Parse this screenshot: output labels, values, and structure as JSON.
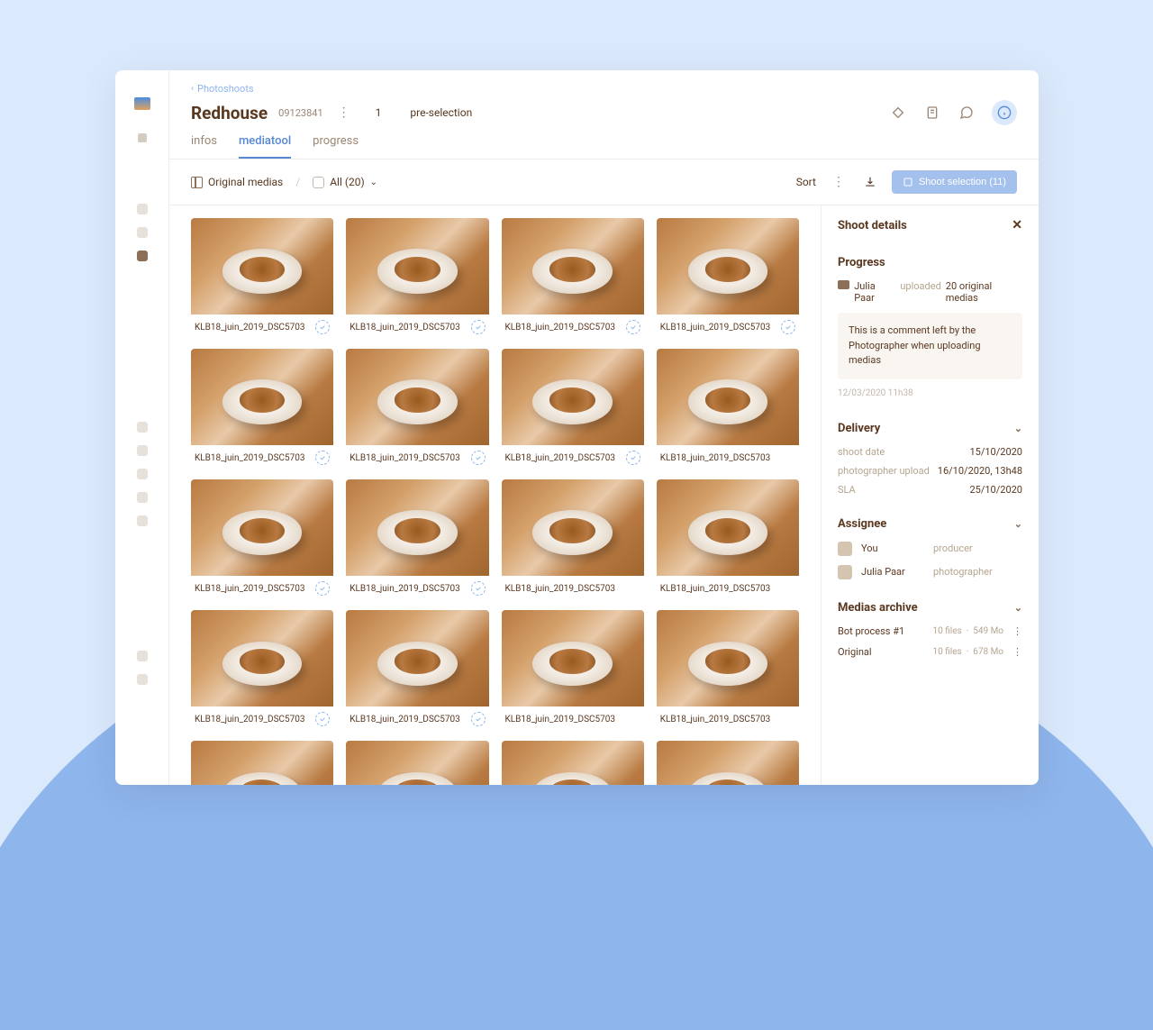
{
  "breadcrumb": {
    "back": "Photoshoots"
  },
  "header": {
    "title": "Redhouse",
    "shoot_id": "09123841",
    "step_number": "1",
    "step_label": "pre-selection"
  },
  "tabs": {
    "infos": "infos",
    "mediatool": "mediatool",
    "progress": "progress"
  },
  "toolbar": {
    "original_medias": "Original medias",
    "all_label": "All (20)",
    "sort": "Sort",
    "shoot_selection": "Shoot selection (11)"
  },
  "media": {
    "items": [
      {
        "filename": "KLB18_juin_2019_DSC5703",
        "badge": true
      },
      {
        "filename": "KLB18_juin_2019_DSC5703",
        "badge": true
      },
      {
        "filename": "KLB18_juin_2019_DSC5703",
        "badge": true
      },
      {
        "filename": "KLB18_juin_2019_DSC5703",
        "badge": true
      },
      {
        "filename": "KLB18_juin_2019_DSC5703",
        "badge": true
      },
      {
        "filename": "KLB18_juin_2019_DSC5703",
        "badge": true
      },
      {
        "filename": "KLB18_juin_2019_DSC5703",
        "badge": true
      },
      {
        "filename": "KLB18_juin_2019_DSC5703",
        "badge": false
      },
      {
        "filename": "KLB18_juin_2019_DSC5703",
        "badge": true
      },
      {
        "filename": "KLB18_juin_2019_DSC5703",
        "badge": true
      },
      {
        "filename": "KLB18_juin_2019_DSC5703",
        "badge": false
      },
      {
        "filename": "KLB18_juin_2019_DSC5703",
        "badge": false
      },
      {
        "filename": "KLB18_juin_2019_DSC5703",
        "badge": true
      },
      {
        "filename": "KLB18_juin_2019_DSC5703",
        "badge": true
      },
      {
        "filename": "KLB18_juin_2019_DSC5703",
        "badge": false
      },
      {
        "filename": "KLB18_juin_2019_DSC5703",
        "badge": false
      },
      {
        "filename": "",
        "badge": false
      },
      {
        "filename": "",
        "badge": false
      },
      {
        "filename": "",
        "badge": false
      },
      {
        "filename": "",
        "badge": false
      }
    ]
  },
  "details": {
    "panel_title": "Shoot details",
    "progress": {
      "title": "Progress",
      "actor": "Julia Paar",
      "verb": "uploaded",
      "object": "20 original medias",
      "comment": "This is a comment left by the Photographer when uploading medias",
      "timestamp": "12/03/2020 11h38"
    },
    "delivery": {
      "title": "Delivery",
      "shoot_date_k": "shoot date",
      "shoot_date_v": "15/10/2020",
      "upload_k": "photographer upload",
      "upload_v": "16/10/2020, 13h48",
      "sla_k": "SLA",
      "sla_v": "25/10/2020"
    },
    "assignee": {
      "title": "Assignee",
      "rows": [
        {
          "name": "You",
          "role": "producer"
        },
        {
          "name": "Julia Paar",
          "role": "photographer"
        }
      ]
    },
    "archive": {
      "title": "Medias archive",
      "rows": [
        {
          "name": "Bot process #1",
          "files": "10 files",
          "sep": "·",
          "size": "549 Mo"
        },
        {
          "name": "Original",
          "files": "10 files",
          "sep": "·",
          "size": "678 Mo"
        }
      ]
    }
  }
}
